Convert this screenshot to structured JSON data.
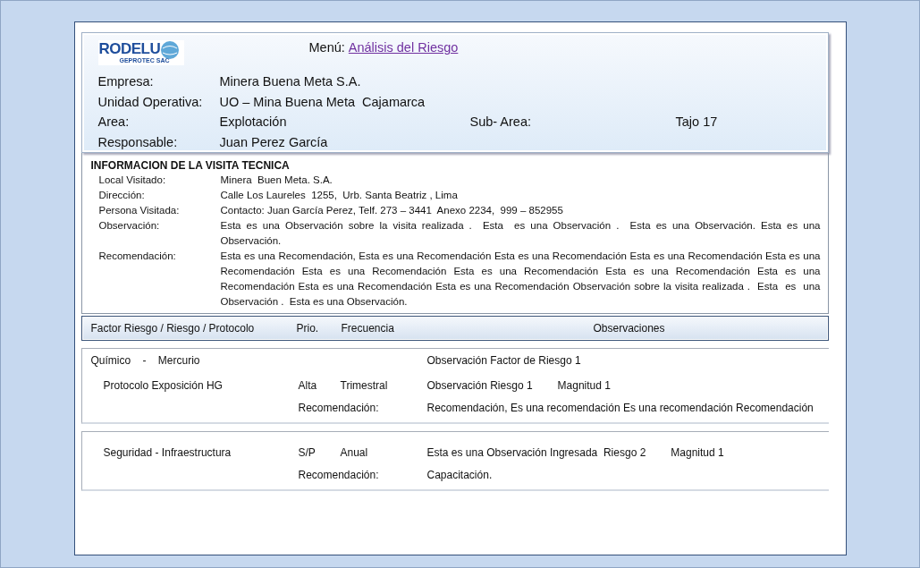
{
  "header": {
    "logo": {
      "name": "RODELU",
      "subtitle": "GEPROTEC SAC"
    },
    "menu": {
      "label": "Menú:",
      "link": "Análisis del Riesgo"
    },
    "fields": [
      {
        "label": "Empresa:",
        "value": "Minera Buena Meta S.A."
      },
      {
        "label": "Unidad Operativa:",
        "value": "UO – Mina Buena Meta  Cajamarca"
      },
      {
        "label": "Area:",
        "value": "Explotación",
        "extra_label": "Sub- Area:",
        "extra_value": "Tajo 17"
      },
      {
        "label": "Responsable:",
        "value": "Juan Perez García"
      }
    ]
  },
  "visit": {
    "title": "INFORMACION DE LA  VISITA  TECNICA",
    "items": [
      {
        "label": "Local Visitado:",
        "value": "Minera  Buen Meta. S.A."
      },
      {
        "label": "Dirección:",
        "value": "Calle Los Laureles  1255,  Urb. Santa Beatriz , Lima"
      },
      {
        "label": "Persona Visitada:",
        "value": "Contacto: Juan García Perez, Telf. 273 – 3441  Anexo 2234,  999 – 852955"
      },
      {
        "label": "Observación:",
        "value": "Esta es una Observación sobre la visita realizada .  Esta  es una Observación .  Esta es una Observación. Esta es una Observación."
      },
      {
        "label": "Recomendación:",
        "value": "Esta es una Recomendación, Esta es una Recomendación Esta es una Recomendación Esta es una Recomendación Esta es una Recomendación Esta es una Recomendación Esta es una Recomendación Esta es una Recomendación Esta es una Recomendación Esta es una Recomendación Esta es una Recomendación Observación sobre la visita realizada .  Esta  es  una Observación .  Esta es una Observación."
      }
    ]
  },
  "table": {
    "columns": [
      "Factor Riesgo / Riesgo / Protocolo",
      "Prio.",
      "Frecuencia",
      "Observaciones"
    ],
    "groups": [
      {
        "factor": "Químico    -    Mercurio",
        "factor_observation": "Observación Factor de Riesgo 1",
        "risks": [
          {
            "name": "Protocolo Exposición HG",
            "priority": "Alta",
            "frequency": "Trimestral",
            "observation": "Observación Riesgo 1",
            "magnitude": "Magnitud 1",
            "recommendation_label": "Recomendación:",
            "recommendation": "Recomendación, Es una recomendación Es una recomendación Recomendación"
          }
        ]
      },
      {
        "risks": [
          {
            "name": "Seguridad - Infraestructura",
            "priority": "S/P",
            "frequency": "Anual",
            "observation": "Esta es una Observación Ingresada  Riesgo 2",
            "magnitude": "Magnitud 1",
            "recommendation_label": "Recomendación:",
            "recommendation": "Capacitación."
          }
        ]
      }
    ]
  }
}
